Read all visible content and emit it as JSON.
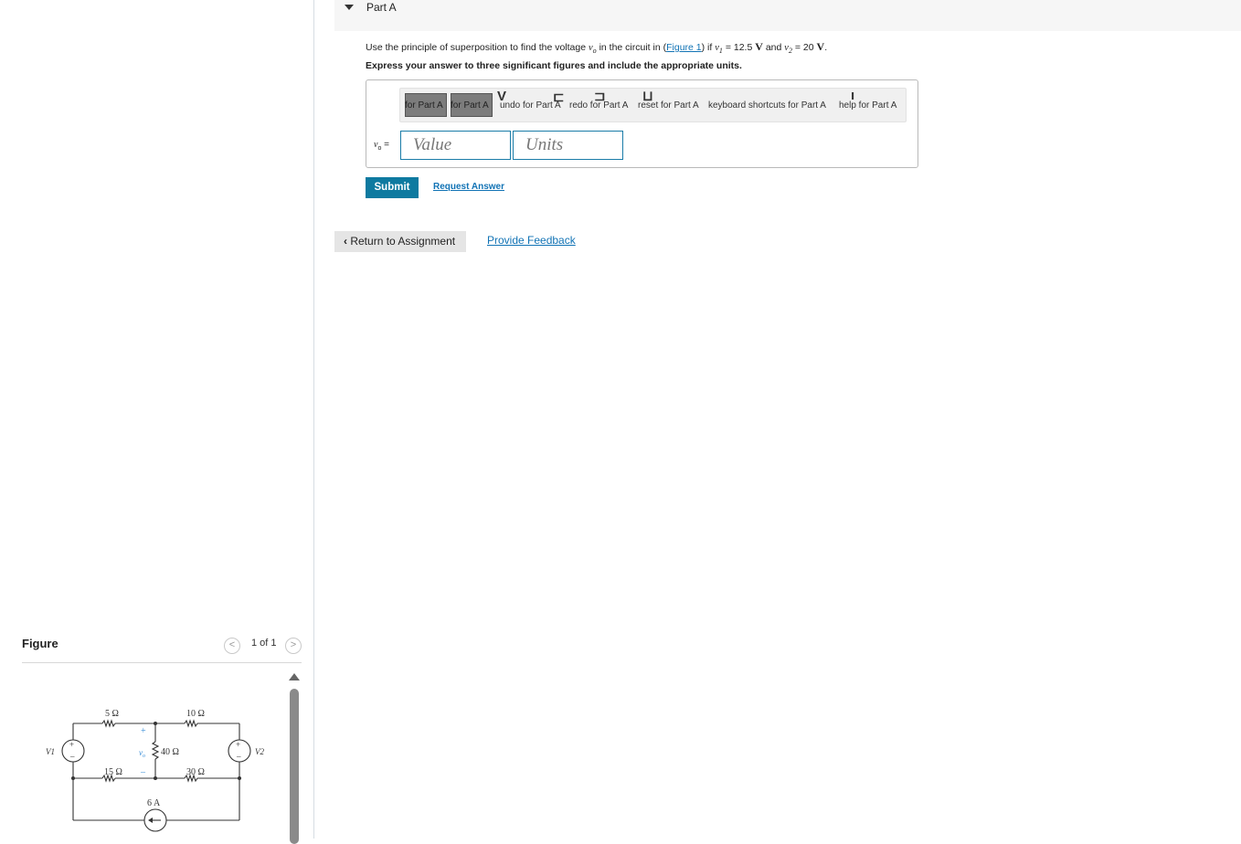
{
  "part": {
    "title": "Part A"
  },
  "question": {
    "prefix": "Use the principle of superposition to find the voltage ",
    "var_vo": "v",
    "var_vo_sub": "o",
    "mid1": " in the circuit in (",
    "figure_link": "Figure 1",
    "mid2": ") if ",
    "var_v1": "v",
    "var_v1_sub": "1",
    "mid3": " = 12.5 ",
    "unit1": "V",
    "mid4": " and ",
    "var_v2": "v",
    "var_v2_sub": "2",
    "mid5": " = 20 ",
    "unit2": "V",
    "suffix": ".",
    "instruction": "Express your answer to three significant figures and include the appropriate units."
  },
  "toolbar": {
    "btn1_label": "for Part A",
    "btn2_label": "for Part A",
    "undo": "undo for Part A",
    "redo": "redo for Part A",
    "reset": "reset for Part A",
    "shortcuts": "keyboard shortcuts for Part A",
    "help": "help for Part A"
  },
  "answer": {
    "var": "v",
    "var_sub": "o",
    "eq": " =",
    "value_placeholder": "Value",
    "units_placeholder": "Units"
  },
  "actions": {
    "submit": "Submit",
    "request": "Request Answer",
    "return": "Return to Assignment",
    "feedback": "Provide Feedback"
  },
  "figure": {
    "title": "Figure",
    "pager": "1 of 1",
    "prev": "<",
    "next": ">",
    "labels": {
      "r5": "5 Ω",
      "r10": "10 Ω",
      "r40": "40 Ω",
      "r15": "15 Ω",
      "r30": "30 Ω",
      "i6": "6 A",
      "v1": "V1",
      "v2": "V2",
      "vo": "v",
      "vo_sub": "o",
      "plus": "+",
      "minus": "–"
    }
  },
  "colors": {
    "accent": "#0e7aa0",
    "link": "#1173b5"
  }
}
